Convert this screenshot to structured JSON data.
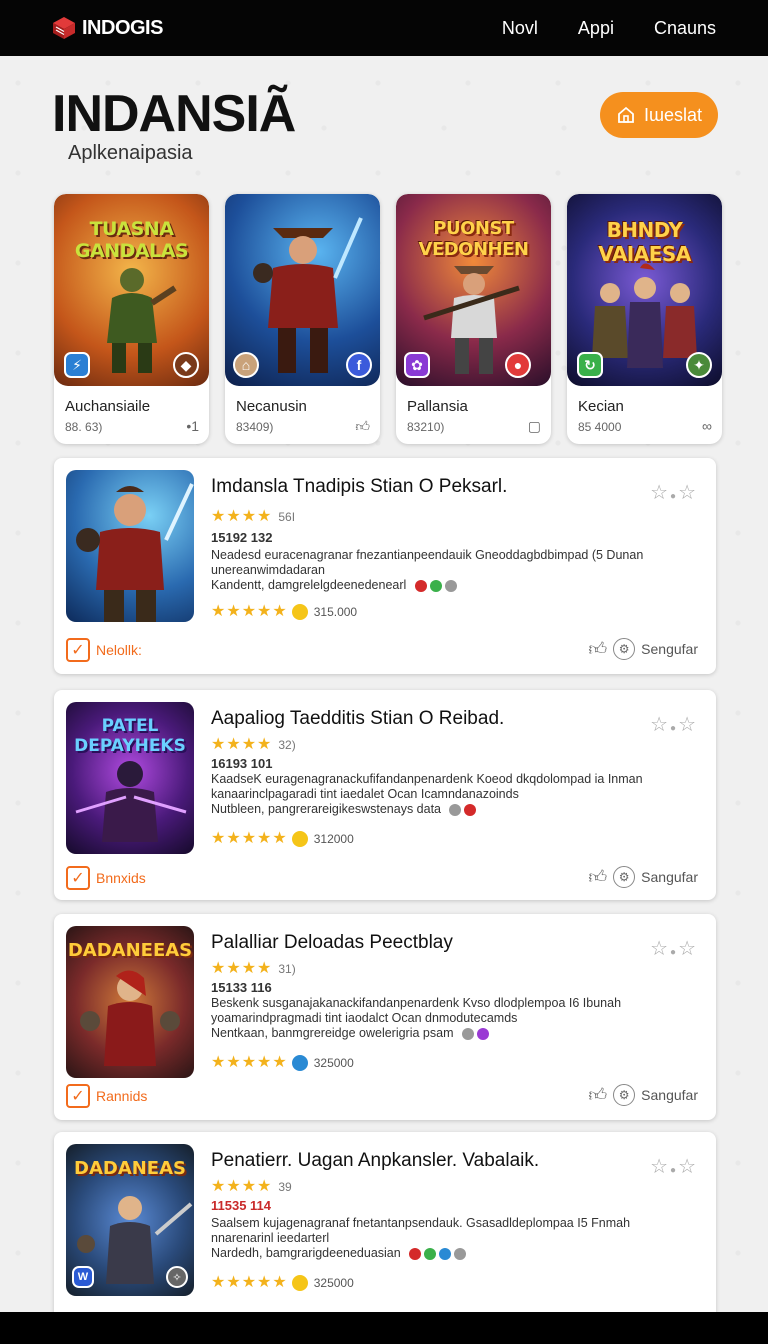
{
  "header": {
    "logo_text": "INDOGIS",
    "nav": [
      "Novl",
      "Appi",
      "Cnauns"
    ]
  },
  "hero": {
    "title": "INDANSIÃ",
    "subtitle": "Aplkenaipasia",
    "install_label": "Iɯeslat"
  },
  "featured": [
    {
      "art_title": "TUASNA GANDALAS",
      "name": "Auchansiaile",
      "count": "88. 63)",
      "icon": "•1"
    },
    {
      "art_title": "",
      "name": "Necanusin",
      "count": "83409)",
      "icon": "like-icon"
    },
    {
      "art_title": "PUONST VEDONHEN",
      "name": "Pallansia",
      "count": "83210)",
      "icon": "square-icon"
    },
    {
      "art_title": "BHNDY VAIAESA",
      "name": "Kecian",
      "count": "85 4000",
      "icon": "link-icon"
    }
  ],
  "list": [
    {
      "thumb_title": "",
      "title": "Imdansla Tnadipis Stian O Peksarl.",
      "rating_text": "56I",
      "code": "15192 132",
      "desc1": "Neadesd euracenagranar fnezantianpeendauik Gneoddagbdbimpad (5 Dunan",
      "desc2": "unereanwimdadaran",
      "desc3": "Kandentt, damgrelelgdeenedenearl",
      "price": "315.000",
      "check_label": "Nelollk:",
      "action_label": "Sengufar"
    },
    {
      "thumb_title": "PATEL DEPAYHEKS",
      "title": "Aapaliog Taedditis Stian O Reibad.",
      "rating_text": "32)",
      "code": "16193 101",
      "desc1": "KaadseK euragenagranackufifandanpenardenk Koeod dkqdolompad ia Inman",
      "desc2": "kanaarinclpagaradi      tint      iaedalet Ocan Icamndanazoinds",
      "desc3": "Nutbleen, pangrerareigikeswstenays data",
      "price": "312000",
      "check_label": "Bnnxids",
      "action_label": "Sangufar"
    },
    {
      "thumb_title": "DADANEEAS",
      "title": "Palalliar Deloadas Peectblay",
      "rating_text": "31)",
      "code": "15133 116",
      "desc1": "Beskenk susganajakanackifandanpenardenk Kvso dlodplempoa I6 Ibunah",
      "desc2": "yoamarindpragmadi      tint      iaodalct Ocan dnmodutecamds",
      "desc3": "Nentkaan, banmgrereidge owelerigria psam",
      "price": "325000",
      "check_label": "Rannids",
      "action_label": "Sangufar"
    },
    {
      "thumb_title": "DADANEAS",
      "title": "Penatierr. Uagan Anpkansler. Vabalaik.",
      "rating_text": "39",
      "code": "11535 114",
      "desc1": "Saalsem kujagenagranaf fnetantanpsendauk. Gsasadldeplompaa I5 Fnmah",
      "desc2": "nnarenarinl ieedarterl",
      "desc3": "Nardedh, bamgrarigdeeneduasian",
      "price": "325000",
      "check_label": "",
      "action_label": ""
    }
  ]
}
